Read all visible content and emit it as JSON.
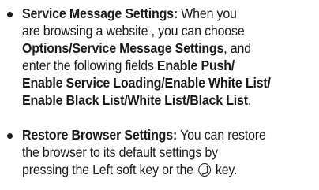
{
  "items": [
    {
      "lines": [
        [
          {
            "text": "Service Message Settings:",
            "bold": true
          },
          {
            "text": " When you",
            "bold": false
          }
        ],
        [
          {
            "text": "are browsing a website , you can choose",
            "bold": false
          }
        ],
        [
          {
            "text": "Options/Service Message Settings",
            "bold": true
          },
          {
            "text": ", and",
            "bold": false
          }
        ],
        [
          {
            "text": "enter the following fields ",
            "bold": false
          },
          {
            "text": "Enable Push/",
            "bold": true
          }
        ],
        [
          {
            "text": "Enable Service Loading/Enable White List/",
            "bold": true
          }
        ],
        [
          {
            "text": "Enable Black List/White List/Black List",
            "bold": true
          },
          {
            "text": ".",
            "bold": false
          }
        ]
      ]
    },
    {
      "lines": [
        [
          {
            "text": "Restore Browser Settings:",
            "bold": true
          },
          {
            "text": " You can restore",
            "bold": false
          }
        ],
        [
          {
            "text": "the browser to its default settings by",
            "bold": false
          }
        ],
        [
          {
            "text": "pressing the Left soft key or the ",
            "bold": false
          },
          {
            "icon": "end-key-icon"
          },
          {
            "text": " key.",
            "bold": false
          }
        ]
      ]
    }
  ]
}
